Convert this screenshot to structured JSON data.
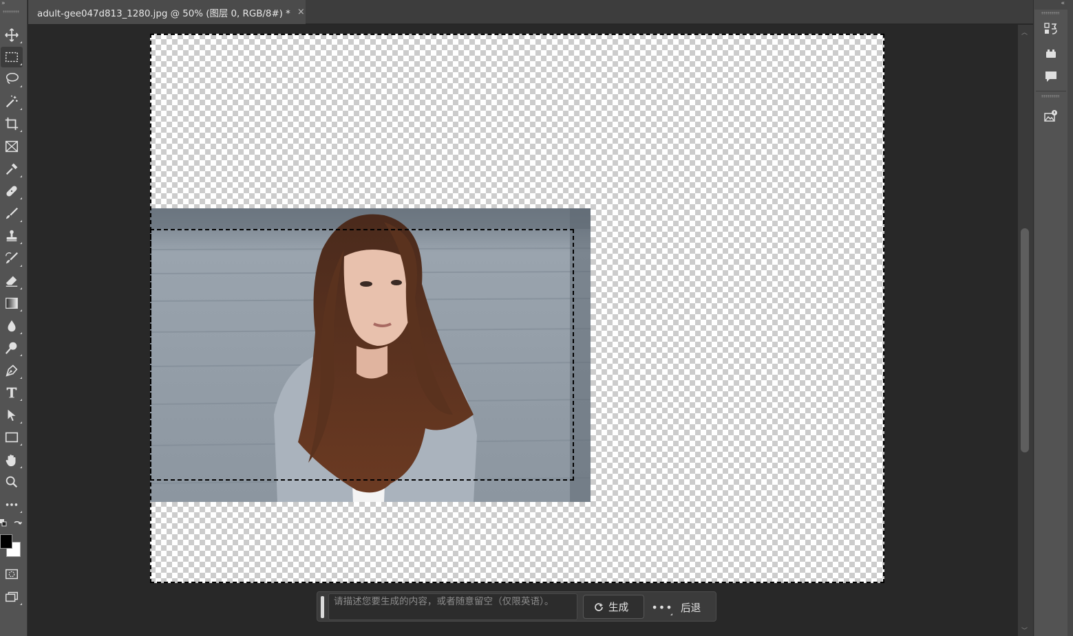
{
  "document": {
    "tab_title": "adult-gee047d813_1280.jpg @ 50% (图层 0, RGB/8#) *",
    "close_glyph": "×"
  },
  "toolbar": {
    "tools": [
      {
        "name": "move-tool",
        "icon": "move-icon",
        "active": false
      },
      {
        "name": "rectangular-marquee-tool",
        "icon": "marquee-icon",
        "active": true
      },
      {
        "name": "lasso-tool",
        "icon": "lasso-icon",
        "active": false
      },
      {
        "name": "magic-wand-tool",
        "icon": "magic-wand-icon",
        "active": false
      },
      {
        "name": "crop-tool",
        "icon": "crop-icon",
        "active": false
      },
      {
        "name": "frame-tool",
        "icon": "frame-icon",
        "active": false
      },
      {
        "name": "eyedropper-tool",
        "icon": "eyedropper-icon",
        "active": false
      },
      {
        "name": "healing-brush-tool",
        "icon": "bandage-icon",
        "active": false
      },
      {
        "name": "brush-tool",
        "icon": "brush-icon",
        "active": false
      },
      {
        "name": "clone-stamp-tool",
        "icon": "stamp-icon",
        "active": false
      },
      {
        "name": "history-brush-tool",
        "icon": "history-brush-icon",
        "active": false
      },
      {
        "name": "eraser-tool",
        "icon": "eraser-icon",
        "active": false
      },
      {
        "name": "gradient-tool",
        "icon": "gradient-icon",
        "active": false
      },
      {
        "name": "blur-tool",
        "icon": "drop-icon",
        "active": false
      },
      {
        "name": "dodge-tool",
        "icon": "dodge-icon",
        "active": false
      },
      {
        "name": "pen-tool",
        "icon": "pen-icon",
        "active": false
      },
      {
        "name": "type-tool",
        "icon": "type-icon",
        "active": false
      },
      {
        "name": "path-selection-tool",
        "icon": "arrow-icon",
        "active": false
      },
      {
        "name": "rectangle-tool",
        "icon": "rectangle-icon",
        "active": false
      },
      {
        "name": "hand-tool",
        "icon": "hand-icon",
        "active": false
      },
      {
        "name": "zoom-tool",
        "icon": "zoom-icon",
        "active": false
      },
      {
        "name": "edit-toolbar",
        "icon": "more-icon",
        "active": false
      }
    ],
    "colors": {
      "foreground": "#000000",
      "background": "#ffffff"
    }
  },
  "taskbar": {
    "prompt_placeholder": "请描述您要生成的内容，或者随意留空（仅限英语）。",
    "generate_label": "生成",
    "more_label": "•••",
    "undo_label": "后退"
  },
  "colors": {
    "workspace": "#282828",
    "toolbar": "#535353",
    "tab_active": "#4b4b4b"
  }
}
